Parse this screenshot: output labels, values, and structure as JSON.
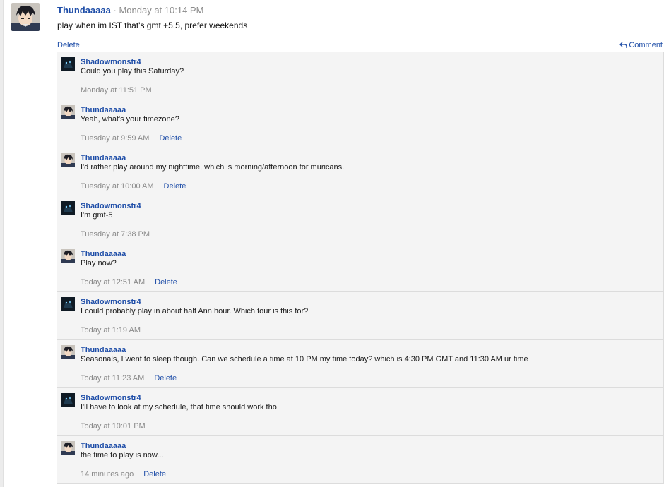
{
  "post": {
    "author": "Thundaaaaa",
    "separator": "·",
    "timestamp": "Monday at 10:14 PM",
    "text": "play when im IST that's gmt +5.5, prefer weekends",
    "delete_label": "Delete",
    "comment_label": "Comment",
    "avatar_icon": "anime-avatar-icon"
  },
  "replies": [
    {
      "author": "Shadowmonstr4",
      "text": "Could you play this Saturday?",
      "time": "Monday at 11:51 PM",
      "delete": ""
    },
    {
      "author": "Thundaaaaa",
      "text": "Yeah, what's your timezone?",
      "time": "Tuesday at 9:59 AM",
      "delete": "Delete"
    },
    {
      "author": "Thundaaaaa",
      "text": "I'd rather play around my nighttime, which is morning/afternoon for muricans.",
      "time": "Tuesday at 10:00 AM",
      "delete": "Delete"
    },
    {
      "author": "Shadowmonstr4",
      "text": "I'm gmt-5",
      "time": "Tuesday at 7:38 PM",
      "delete": ""
    },
    {
      "author": "Thundaaaaa",
      "text": "Play now?",
      "time": "Today at 12:51 AM",
      "delete": "Delete"
    },
    {
      "author": "Shadowmonstr4",
      "text": "I could probably play in about half Ann hour. Which tour is this for?",
      "time": "Today at 1:19 AM",
      "delete": ""
    },
    {
      "author": "Thundaaaaa",
      "text": "Seasonals, I went to sleep though. Can we schedule a time at 10 PM my time today? which is 4:30 PM GMT and 11:30 AM ur time",
      "time": "Today at 11:23 AM",
      "delete": "Delete"
    },
    {
      "author": "Shadowmonstr4",
      "text": "I'll have to look at my schedule, that time should work tho",
      "time": "Today at 10:01 PM",
      "delete": ""
    },
    {
      "author": "Thundaaaaa",
      "text": "the time to play is now...",
      "time": "14 minutes ago",
      "delete": "Delete"
    }
  ],
  "colors": {
    "link": "#1f4ea8",
    "meta": "#8a8a8a",
    "thread_bg": "#f4f4f4"
  }
}
